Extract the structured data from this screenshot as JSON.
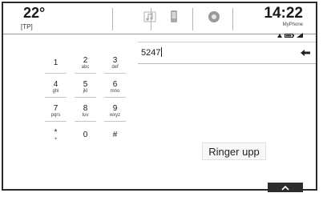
{
  "status": {
    "temperature": "22°",
    "traffic_program": "[TP]",
    "clock": "14:22",
    "phone_name": "MyPhone"
  },
  "tabs": {
    "audio_icon": "music-note-icon",
    "phone_icon": "mobile-phone-icon",
    "status_icon": "circle-status-icon"
  },
  "dialer": {
    "entered_number": "5247",
    "keys": [
      {
        "digit": "1",
        "letters": ""
      },
      {
        "digit": "2",
        "letters": "abc"
      },
      {
        "digit": "3",
        "letters": "def"
      },
      {
        "digit": "4",
        "letters": "ghi"
      },
      {
        "digit": "5",
        "letters": "jkl"
      },
      {
        "digit": "6",
        "letters": "mno"
      },
      {
        "digit": "7",
        "letters": "pqrs"
      },
      {
        "digit": "8",
        "letters": "tuv"
      },
      {
        "digit": "9",
        "letters": "wxyz"
      },
      {
        "digit": "*",
        "letters": "+"
      },
      {
        "digit": "0",
        "letters": ""
      },
      {
        "digit": "#",
        "letters": ""
      }
    ],
    "call_label": "Ringer upp"
  },
  "colors": {
    "frame": "#2b2b2b",
    "tab_bar": "#2c2c2c"
  }
}
